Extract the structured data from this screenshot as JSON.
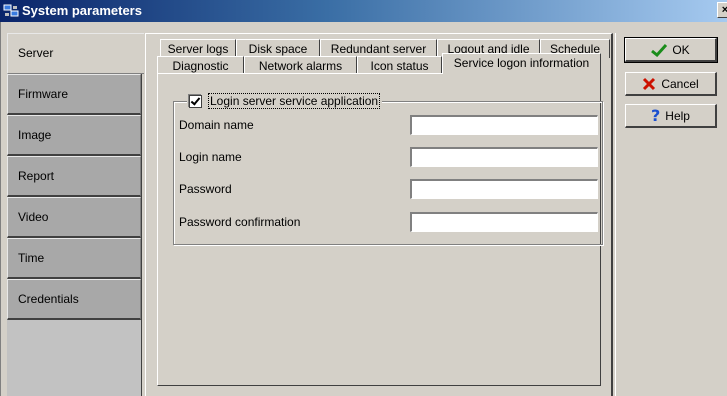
{
  "window": {
    "title": "System parameters",
    "close_label": "×"
  },
  "sidebar": {
    "items": [
      {
        "label": "Server",
        "active": true
      },
      {
        "label": "Firmware"
      },
      {
        "label": "Image"
      },
      {
        "label": "Report"
      },
      {
        "label": "Video"
      },
      {
        "label": "Time"
      },
      {
        "label": "Credentials"
      }
    ]
  },
  "tabs": {
    "row1": [
      "Server logs",
      "Disk space",
      "Redundant server",
      "Logout and idle",
      "Schedule"
    ],
    "row2": [
      "Diagnostic",
      "Network alarms",
      "Icon status",
      "Service logon information"
    ],
    "active": "Service logon information"
  },
  "form": {
    "group_label": "Login server service application",
    "group_checked": true,
    "fields": [
      {
        "label": "Domain name",
        "value": ""
      },
      {
        "label": "Login name",
        "value": ""
      },
      {
        "label": "Password",
        "value": ""
      },
      {
        "label": "Password confirmation",
        "value": ""
      }
    ]
  },
  "buttons": {
    "ok": "OK",
    "cancel": "Cancel",
    "help": "Help"
  },
  "colors": {
    "ok_icon": "#1a8c1a",
    "cancel_icon": "#cc1100",
    "help_icon": "#1a4fd0"
  }
}
